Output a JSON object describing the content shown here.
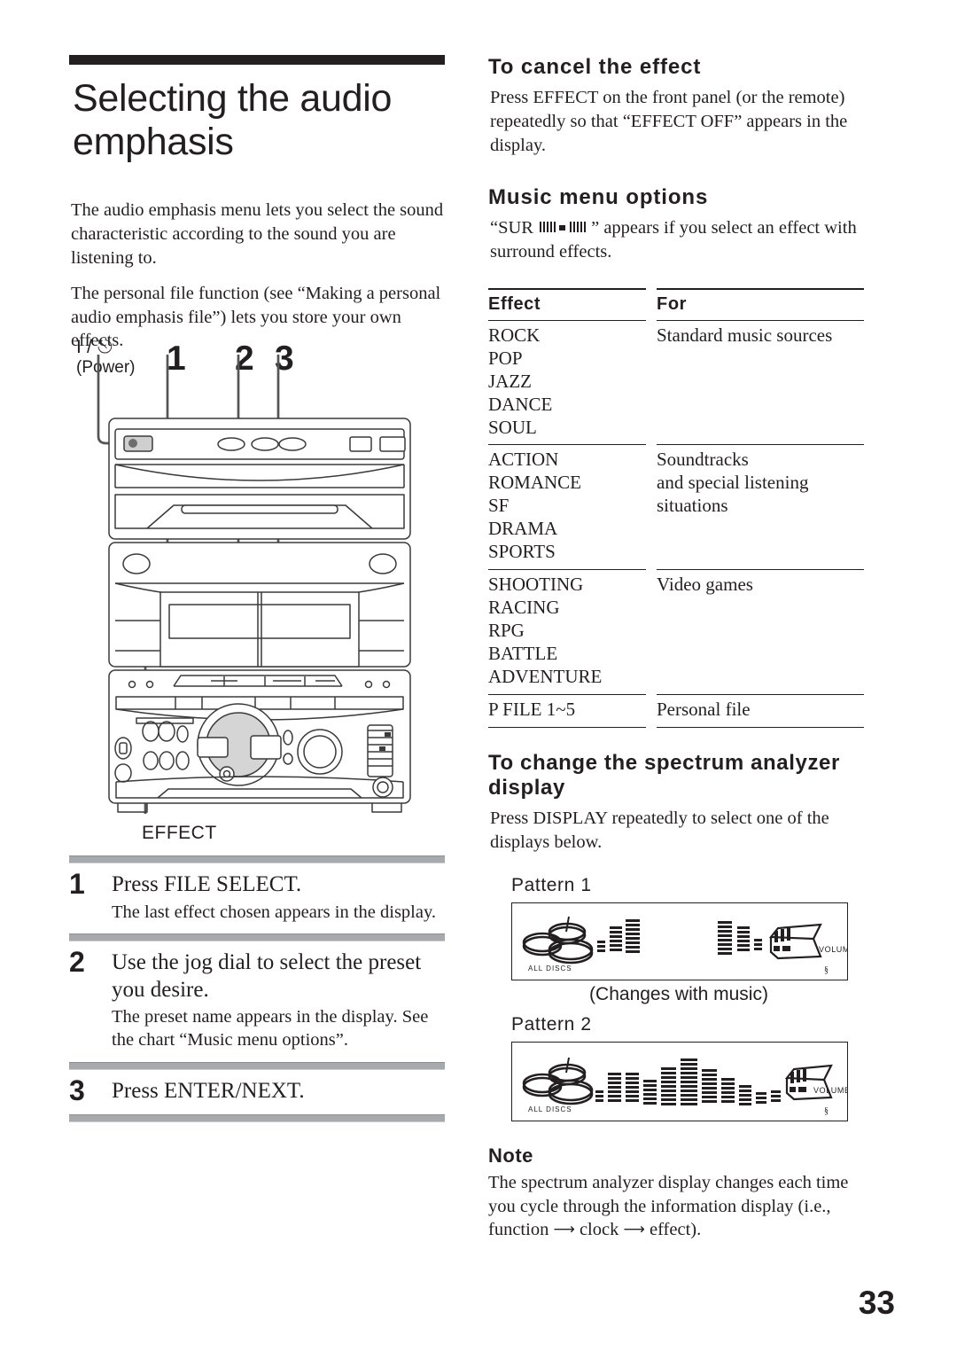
{
  "document": {
    "page_number": "33"
  },
  "left": {
    "title": "Selecting the audio emphasis",
    "intro_1": "The audio emphasis menu lets you select the sound characteristic according to the sound you are listening to.",
    "intro_2": "The personal file function (see “Making a personal audio emphasis file”) lets you store your own effects.",
    "power_symbol": "ⓦ",
    "power_symbol_text": "I / ⏻",
    "power_label": "(Power)",
    "callouts": [
      "1",
      "2",
      "3"
    ],
    "effect_button_label": "EFFECT",
    "steps": [
      {
        "num": "1",
        "main": "Press FILE SELECT.",
        "sub": "The last effect chosen appears in the display."
      },
      {
        "num": "2",
        "main": "Use the jog dial to select the preset you desire.",
        "sub": "The preset name appears in the display. See the chart “Music menu options”."
      },
      {
        "num": "3",
        "main": "Press ENTER/NEXT.",
        "sub": ""
      }
    ]
  },
  "right": {
    "cancel_heading": "To cancel the effect",
    "cancel_body": "Press EFFECT on the front panel (or the remote) repeatedly so that “EFFECT OFF” appears in the display.",
    "music_menu_heading": "Music menu options",
    "sur_note_before": "“SUR ",
    "sur_note_after": "” appears if you select an effect with surround effects.",
    "table": {
      "headers": [
        "Effect",
        "For"
      ],
      "groups": [
        {
          "effects": [
            "ROCK",
            "POP",
            "JAZZ",
            "DANCE",
            "SOUL"
          ],
          "for": [
            "Standard music sources"
          ]
        },
        {
          "effects": [
            "ACTION",
            "ROMANCE",
            "SF",
            "DRAMA",
            "SPORTS"
          ],
          "for": [
            "Soundtracks",
            "and special listening",
            "situations"
          ]
        },
        {
          "effects": [
            "SHOOTING",
            "RACING",
            "RPG",
            "BATTLE",
            "ADVENTURE"
          ],
          "for": [
            "Video games"
          ]
        },
        {
          "effects": [
            "P FILE 1~5"
          ],
          "for": [
            "Personal file"
          ]
        }
      ]
    },
    "spectrum_heading": "To change the spectrum analyzer display",
    "spectrum_body": "Press DISPLAY repeatedly to select one of the displays below.",
    "pattern_1_label": "Pattern 1",
    "pattern_1_caption": "(Changes with music)",
    "pattern_2_label": "Pattern 2",
    "display_labels": {
      "all_discs": "ALL  DISCS",
      "volume": "VOLUME"
    },
    "note_heading": "Note",
    "note_body_1": "The spectrum analyzer display changes each time you cycle through the information display (i.e.,",
    "note_body_2_a": "function ",
    "note_body_2_b": " clock ",
    "note_body_2_c": " effect)."
  },
  "colors": {
    "ink": "#231f20",
    "rule_gray": "#a7aaad",
    "figure_line": "#3a3a3a"
  }
}
